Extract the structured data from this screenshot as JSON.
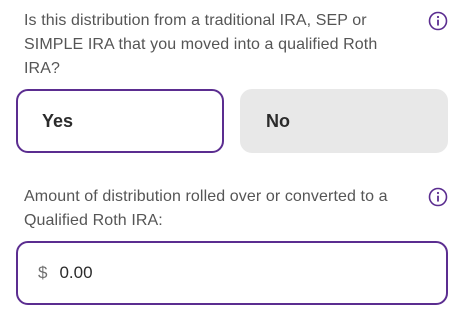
{
  "questions": {
    "source_question": "Is this distribution from a traditional IRA, SEP or SIMPLE IRA that you moved into a qualified Roth IRA?",
    "amount_question": "Amount of distribution rolled over or converted to a Qualified Roth IRA:"
  },
  "choices": {
    "yes_label": "Yes",
    "no_label": "No",
    "selected": "Yes"
  },
  "amount": {
    "currency_symbol": "$",
    "value": "0.00"
  },
  "icons": {
    "info": "info-circle-icon"
  },
  "colors": {
    "accent": "#5b2d90",
    "unselected_bg": "#e8e8e8",
    "question_text": "#555555"
  }
}
